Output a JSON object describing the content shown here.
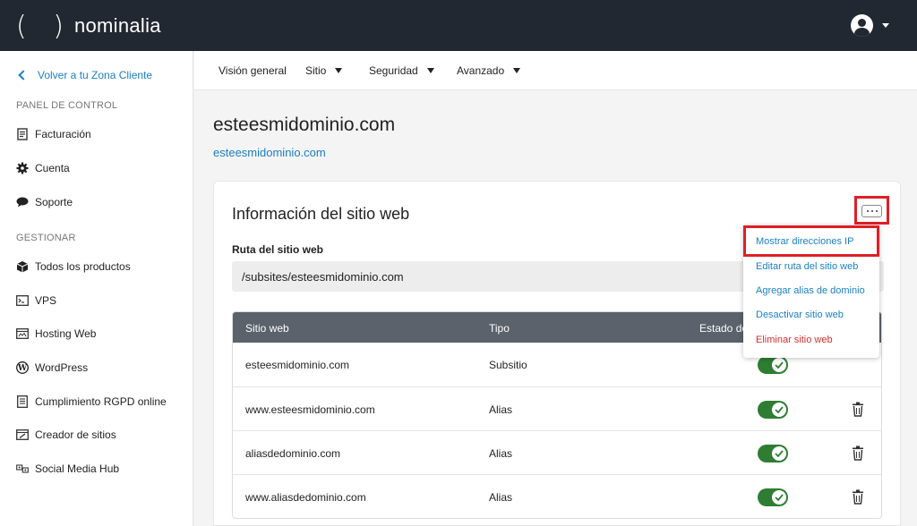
{
  "topbar": {
    "logo_parens": "( )",
    "logo_text": "nominalia"
  },
  "sidebar": {
    "back_label": "Volver a tu Zona Cliente",
    "section_control": "PANEL DE CONTROL",
    "control_items": [
      {
        "label": "Facturación",
        "icon": "invoice-icon"
      },
      {
        "label": "Cuenta",
        "icon": "gear-icon"
      },
      {
        "label": "Soporte",
        "icon": "chat-bubble-icon"
      }
    ],
    "section_manage": "GESTIONAR",
    "manage_items": [
      {
        "label": "Todos los productos",
        "icon": "box-icon"
      },
      {
        "label": "VPS",
        "icon": "terminal-icon"
      },
      {
        "label": "Hosting Web",
        "icon": "hosting-icon"
      },
      {
        "label": "WordPress",
        "icon": "wordpress-icon"
      },
      {
        "label": "Cumplimiento RGPD online",
        "icon": "document-list-icon"
      },
      {
        "label": "Creador de sitios",
        "icon": "site-builder-icon"
      },
      {
        "label": "Social Media Hub",
        "icon": "social-icon"
      }
    ]
  },
  "subnav": {
    "items": [
      {
        "label": "Visión general"
      },
      {
        "label": "Sitio"
      },
      {
        "label": "Seguridad"
      },
      {
        "label": "Avanzado"
      }
    ]
  },
  "main": {
    "title": "esteesmidominio.com",
    "link": "esteesmidominio.com",
    "card_title": "Información del sitio web",
    "route_label": "Ruta del sitio web",
    "route_value": "/subsites/esteesmidominio.com"
  },
  "table": {
    "headers": [
      "Sitio web",
      "Tipo",
      "Estado de"
    ],
    "rows": [
      {
        "site": "esteesmidominio.com",
        "type": "Subsitio",
        "enabled": true
      },
      {
        "site": "www.esteesmidominio.com",
        "type": "Alias",
        "enabled": true
      },
      {
        "site": "aliasdedominio.com",
        "type": "Alias",
        "enabled": true
      },
      {
        "site": "www.aliasdedominio.com",
        "type": "Alias",
        "enabled": true
      }
    ]
  },
  "dropdown": {
    "items": [
      {
        "label": "Mostrar direcciones IP"
      },
      {
        "label": "Editar ruta del sitio web"
      },
      {
        "label": "Agregar alias de dominio"
      },
      {
        "label": "Desactivar sitio web"
      },
      {
        "label": "Eliminar sitio web"
      }
    ]
  },
  "colors": {
    "topbar": "#222831",
    "link": "#1a7fc1",
    "toggle_on": "#2e7d32",
    "highlight": "#e01e26",
    "danger": "#d32f2f",
    "table_header": "#5b626c"
  }
}
